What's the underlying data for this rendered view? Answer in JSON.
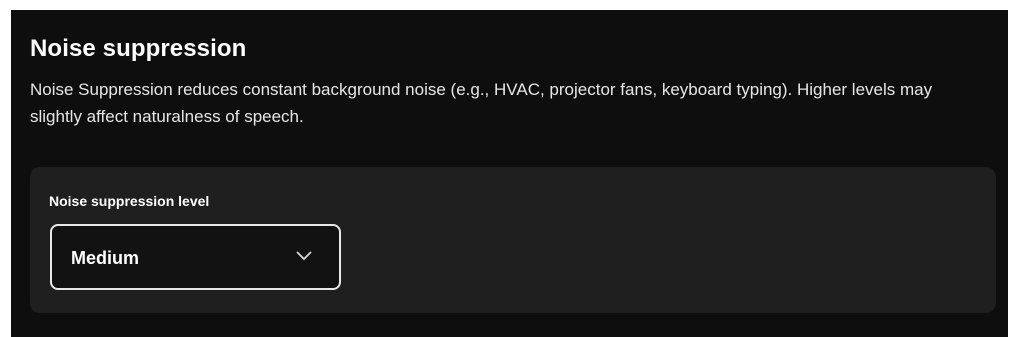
{
  "section": {
    "title": "Noise suppression",
    "description": "Noise Suppression reduces constant background noise (e.g., HVAC, projector fans, keyboard typing). Higher levels may slightly affect naturalness of speech."
  },
  "noise_level": {
    "label": "Noise suppression level",
    "selected": "Medium",
    "icon": "chevron-down-icon"
  },
  "colors": {
    "panel_background": "#0e0e0e",
    "card_background": "#1f1f1f",
    "text": "#ffffff",
    "select_border": "#e8e8e8"
  }
}
